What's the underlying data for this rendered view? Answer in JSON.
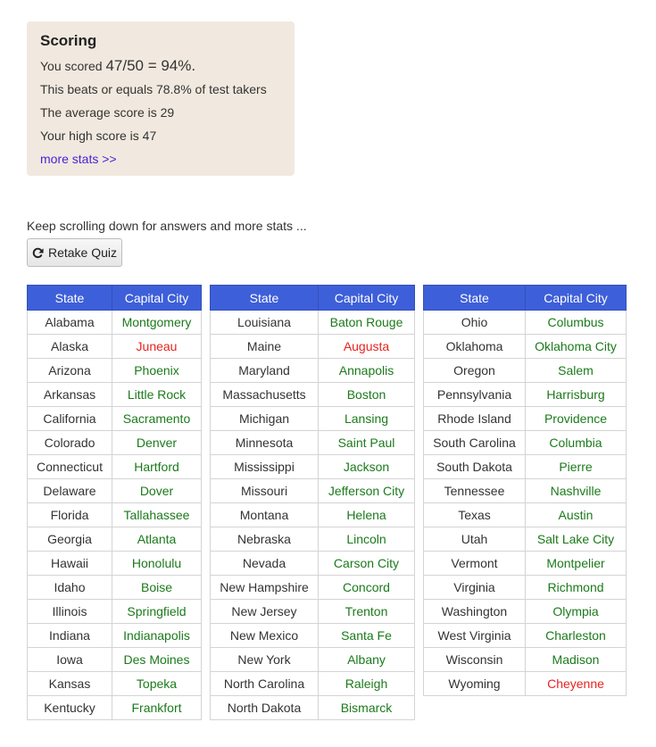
{
  "scoring": {
    "title": "Scoring",
    "score_prefix": "You scored",
    "score_value": "47/50 = 94%.",
    "beats_text": "This beats or equals 78.8% of test takers",
    "average_text": "The average score is 29",
    "high_text": "Your high score is 47",
    "more_stats_label": "more stats >>"
  },
  "hint_text": "Keep scrolling down for answers and more stats ...",
  "retake_label": "Retake Quiz",
  "colors": {
    "correct": "#1b7a1b",
    "incorrect": "#e8231f",
    "header": "#3d5fd9",
    "score_bg": "#f1e9df"
  },
  "table_headers": {
    "state": "State",
    "capital": "Capital City"
  },
  "tables": [
    {
      "rows": [
        {
          "state": "Alabama",
          "capital": "Montgomery",
          "correct": true
        },
        {
          "state": "Alaska",
          "capital": "Juneau",
          "correct": false
        },
        {
          "state": "Arizona",
          "capital": "Phoenix",
          "correct": true
        },
        {
          "state": "Arkansas",
          "capital": "Little Rock",
          "correct": true
        },
        {
          "state": "California",
          "capital": "Sacramento",
          "correct": true
        },
        {
          "state": "Colorado",
          "capital": "Denver",
          "correct": true
        },
        {
          "state": "Connecticut",
          "capital": "Hartford",
          "correct": true
        },
        {
          "state": "Delaware",
          "capital": "Dover",
          "correct": true
        },
        {
          "state": "Florida",
          "capital": "Tallahassee",
          "correct": true
        },
        {
          "state": "Georgia",
          "capital": "Atlanta",
          "correct": true
        },
        {
          "state": "Hawaii",
          "capital": "Honolulu",
          "correct": true
        },
        {
          "state": "Idaho",
          "capital": "Boise",
          "correct": true
        },
        {
          "state": "Illinois",
          "capital": "Springfield",
          "correct": true
        },
        {
          "state": "Indiana",
          "capital": "Indianapolis",
          "correct": true
        },
        {
          "state": "Iowa",
          "capital": "Des Moines",
          "correct": true
        },
        {
          "state": "Kansas",
          "capital": "Topeka",
          "correct": true
        },
        {
          "state": "Kentucky",
          "capital": "Frankfort",
          "correct": true
        }
      ]
    },
    {
      "rows": [
        {
          "state": "Louisiana",
          "capital": "Baton Rouge",
          "correct": true
        },
        {
          "state": "Maine",
          "capital": "Augusta",
          "correct": false
        },
        {
          "state": "Maryland",
          "capital": "Annapolis",
          "correct": true
        },
        {
          "state": "Massachusetts",
          "capital": "Boston",
          "correct": true
        },
        {
          "state": "Michigan",
          "capital": "Lansing",
          "correct": true
        },
        {
          "state": "Minnesota",
          "capital": "Saint Paul",
          "correct": true
        },
        {
          "state": "Mississippi",
          "capital": "Jackson",
          "correct": true
        },
        {
          "state": "Missouri",
          "capital": "Jefferson City",
          "correct": true
        },
        {
          "state": "Montana",
          "capital": "Helena",
          "correct": true
        },
        {
          "state": "Nebraska",
          "capital": "Lincoln",
          "correct": true
        },
        {
          "state": "Nevada",
          "capital": "Carson City",
          "correct": true
        },
        {
          "state": "New Hampshire",
          "capital": "Concord",
          "correct": true
        },
        {
          "state": "New Jersey",
          "capital": "Trenton",
          "correct": true
        },
        {
          "state": "New Mexico",
          "capital": "Santa Fe",
          "correct": true
        },
        {
          "state": "New York",
          "capital": "Albany",
          "correct": true
        },
        {
          "state": "North Carolina",
          "capital": "Raleigh",
          "correct": true
        },
        {
          "state": "North Dakota",
          "capital": "Bismarck",
          "correct": true
        }
      ]
    },
    {
      "rows": [
        {
          "state": "Ohio",
          "capital": "Columbus",
          "correct": true
        },
        {
          "state": "Oklahoma",
          "capital": "Oklahoma City",
          "correct": true
        },
        {
          "state": "Oregon",
          "capital": "Salem",
          "correct": true
        },
        {
          "state": "Pennsylvania",
          "capital": "Harrisburg",
          "correct": true
        },
        {
          "state": "Rhode Island",
          "capital": "Providence",
          "correct": true
        },
        {
          "state": "South Carolina",
          "capital": "Columbia",
          "correct": true
        },
        {
          "state": "South Dakota",
          "capital": "Pierre",
          "correct": true
        },
        {
          "state": "Tennessee",
          "capital": "Nashville",
          "correct": true
        },
        {
          "state": "Texas",
          "capital": "Austin",
          "correct": true
        },
        {
          "state": "Utah",
          "capital": "Salt Lake City",
          "correct": true
        },
        {
          "state": "Vermont",
          "capital": "Montpelier",
          "correct": true
        },
        {
          "state": "Virginia",
          "capital": "Richmond",
          "correct": true
        },
        {
          "state": "Washington",
          "capital": "Olympia",
          "correct": true
        },
        {
          "state": "West Virginia",
          "capital": "Charleston",
          "correct": true
        },
        {
          "state": "Wisconsin",
          "capital": "Madison",
          "correct": true
        },
        {
          "state": "Wyoming",
          "capital": "Cheyenne",
          "correct": false
        }
      ]
    }
  ]
}
